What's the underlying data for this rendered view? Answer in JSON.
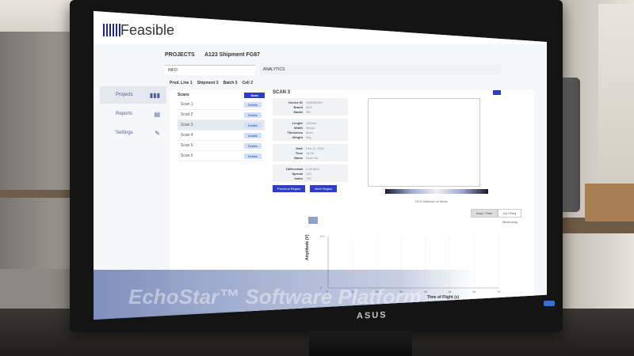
{
  "app": {
    "logo_text": "Feasible",
    "projects_label": "PROJECTS",
    "project_title": "A123 Shipment FG87"
  },
  "sidebar": {
    "items": [
      {
        "label": "Projects",
        "icon": "bar-chart-icon"
      },
      {
        "label": "Reports",
        "icon": "report-icon"
      },
      {
        "label": "Settings",
        "icon": "wrench-icon"
      }
    ]
  },
  "tabs": {
    "info": "INFO",
    "analytics": "ANALYTICS"
  },
  "breadcrumb": [
    "Prod. Line 1",
    "Shipment 3",
    "Batch 5",
    "Cell 2"
  ],
  "scans": {
    "title": "Scans",
    "action_label": "Scan",
    "rows": [
      {
        "label": "Scan 1",
        "button": "Details"
      },
      {
        "label": "Scan 2",
        "button": "Details"
      },
      {
        "label": "Scan 3",
        "button": "Details"
      },
      {
        "label": "Scan 4",
        "button": "Details"
      },
      {
        "label": "Scan 5",
        "button": "Details"
      },
      {
        "label": "Scan 6",
        "button": "Details"
      }
    ]
  },
  "detail": {
    "title": "SCAN 3",
    "block1": [
      {
        "k": "Device ID",
        "v": "US84BTAO"
      },
      {
        "k": "Brand",
        "v": "ACE"
      },
      {
        "k": "Model",
        "v": "SH"
      }
    ],
    "block2": [
      {
        "k": "Length",
        "v": "150mm"
      },
      {
        "k": "Width",
        "v": "94mm"
      },
      {
        "k": "Thickness",
        "v": "5mm"
      },
      {
        "k": "Weight",
        "v": "2kg"
      }
    ],
    "block3": [
      {
        "k": "Date",
        "v": "Feb 11, 2019"
      },
      {
        "k": "Time",
        "v": "14:05"
      },
      {
        "k": "Name",
        "v": "Scan 3a"
      }
    ],
    "block4": [
      {
        "k": "Differential",
        "v": "0.45 MHz"
      },
      {
        "k": "Spread",
        "v": "100"
      },
      {
        "k": "Index",
        "v": "732"
      }
    ],
    "buttons": [
      "Previous Region",
      "Next Region"
    ],
    "heat_caption": "DCS Matches vs Mean",
    "toggles": [
      "Amp / Time",
      "Int / Freq"
    ],
    "legend": "Mean Amp"
  },
  "chart_data": {
    "type": "line",
    "title": "",
    "xlabel": "Time of Flight (s)",
    "ylabel": "Amplitude (V)",
    "x_ticks": [
      "0",
      "1e",
      "2e",
      "3e",
      "4e",
      "5e",
      "6e",
      "7e"
    ],
    "y_ticks": [
      "0.5",
      "0"
    ],
    "series": []
  },
  "watermark": "EchoStar™ Software Platform",
  "monitor_brand": "ASUS"
}
